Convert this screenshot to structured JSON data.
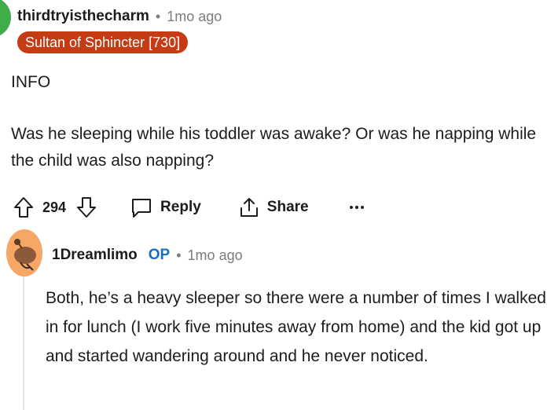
{
  "comment": {
    "username": "thirdtryisthecharm",
    "separator": "•",
    "time": "1mo ago",
    "flair": "Sultan of Sphincter [730]",
    "body": [
      "INFO",
      "Was he sleeping while his toddler was awake? Or was he napping while the child was also napping?"
    ],
    "score": "294",
    "reply_label": "Reply",
    "share_label": "Share",
    "more_label": "···",
    "avatar_color": "#3fae49",
    "flair_color": "#c53b14"
  },
  "reply": {
    "username": "1Dreamlimo",
    "op_badge": "OP",
    "separator": "•",
    "time": "1mo ago",
    "body": "Both, he’s a heavy sleeper so there were a number of times I walked in for lunch (I work five minutes away from home) and the kid got up and started wandering around and he never noticed.",
    "avatar_color": "#f6a766",
    "op_color": "#1b6ec2"
  },
  "icons": {
    "upvote": "upvote-icon",
    "downvote": "downvote-icon",
    "reply": "comment-bubble-icon",
    "share": "share-icon",
    "more": "more-options-icon"
  }
}
